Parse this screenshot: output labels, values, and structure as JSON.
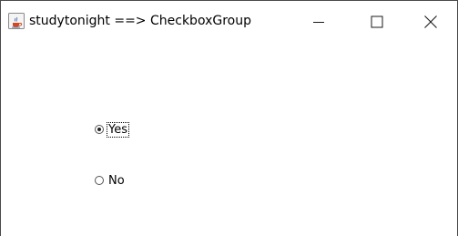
{
  "window": {
    "title": "studytonight ==> CheckboxGroup",
    "app_icon": "java-coffee-icon",
    "controls": [
      "minimize-icon",
      "maximize-icon",
      "close-icon"
    ]
  },
  "checkbox_group": {
    "options": [
      {
        "label": "Yes",
        "selected": true,
        "focused": true
      },
      {
        "label": "No",
        "selected": false,
        "focused": false
      }
    ]
  }
}
